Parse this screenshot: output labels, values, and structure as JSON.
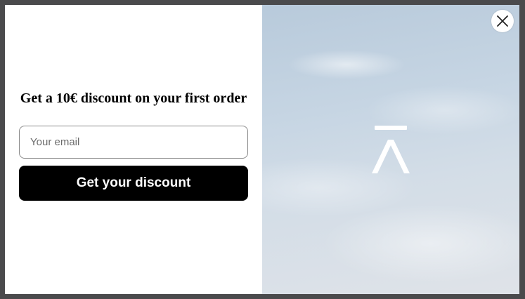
{
  "popup": {
    "headline": "Get a 10€ discount on your first order",
    "email": {
      "placeholder": "Your email",
      "value": ""
    },
    "cta_label": "Get your discount",
    "close_icon": "close-icon",
    "logo_icon": "brand-logo-a-macron"
  },
  "colors": {
    "overlay": "#4a4a4c",
    "button_bg": "#000000",
    "button_text": "#ffffff",
    "headline": "#000000",
    "sky": "#c6d5e3"
  }
}
